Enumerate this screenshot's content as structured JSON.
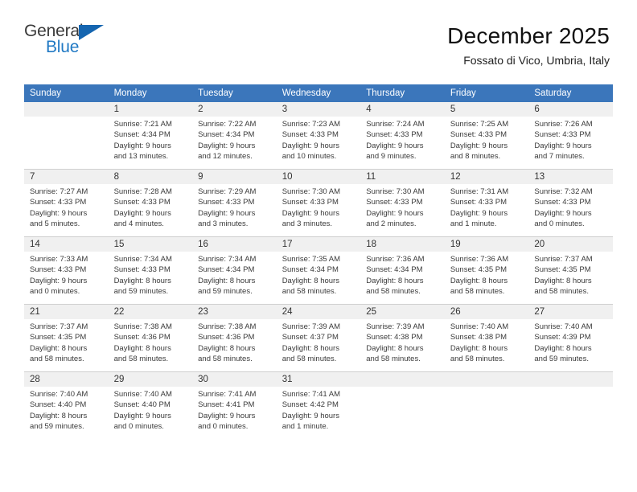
{
  "logo": {
    "general": "General",
    "blue": "Blue",
    "triangle": "blue-triangle-icon"
  },
  "header": {
    "title": "December 2025",
    "subtitle": "Fossato di Vico, Umbria, Italy"
  },
  "colors": {
    "header_blue": "#3b76bb",
    "logo_blue": "#2079c4",
    "daynum_bg": "#f0f0f0",
    "separator": "#cfcfcf"
  },
  "calendar": {
    "weekday_headers": [
      "Sunday",
      "Monday",
      "Tuesday",
      "Wednesday",
      "Thursday",
      "Friday",
      "Saturday"
    ],
    "weeks": [
      {
        "days": [
          {
            "num": "",
            "lines": []
          },
          {
            "num": "1",
            "lines": [
              "Sunrise: 7:21 AM",
              "Sunset: 4:34 PM",
              "Daylight: 9 hours",
              "and 13 minutes."
            ]
          },
          {
            "num": "2",
            "lines": [
              "Sunrise: 7:22 AM",
              "Sunset: 4:34 PM",
              "Daylight: 9 hours",
              "and 12 minutes."
            ]
          },
          {
            "num": "3",
            "lines": [
              "Sunrise: 7:23 AM",
              "Sunset: 4:33 PM",
              "Daylight: 9 hours",
              "and 10 minutes."
            ]
          },
          {
            "num": "4",
            "lines": [
              "Sunrise: 7:24 AM",
              "Sunset: 4:33 PM",
              "Daylight: 9 hours",
              "and 9 minutes."
            ]
          },
          {
            "num": "5",
            "lines": [
              "Sunrise: 7:25 AM",
              "Sunset: 4:33 PM",
              "Daylight: 9 hours",
              "and 8 minutes."
            ]
          },
          {
            "num": "6",
            "lines": [
              "Sunrise: 7:26 AM",
              "Sunset: 4:33 PM",
              "Daylight: 9 hours",
              "and 7 minutes."
            ]
          }
        ]
      },
      {
        "days": [
          {
            "num": "7",
            "lines": [
              "Sunrise: 7:27 AM",
              "Sunset: 4:33 PM",
              "Daylight: 9 hours",
              "and 5 minutes."
            ]
          },
          {
            "num": "8",
            "lines": [
              "Sunrise: 7:28 AM",
              "Sunset: 4:33 PM",
              "Daylight: 9 hours",
              "and 4 minutes."
            ]
          },
          {
            "num": "9",
            "lines": [
              "Sunrise: 7:29 AM",
              "Sunset: 4:33 PM",
              "Daylight: 9 hours",
              "and 3 minutes."
            ]
          },
          {
            "num": "10",
            "lines": [
              "Sunrise: 7:30 AM",
              "Sunset: 4:33 PM",
              "Daylight: 9 hours",
              "and 3 minutes."
            ]
          },
          {
            "num": "11",
            "lines": [
              "Sunrise: 7:30 AM",
              "Sunset: 4:33 PM",
              "Daylight: 9 hours",
              "and 2 minutes."
            ]
          },
          {
            "num": "12",
            "lines": [
              "Sunrise: 7:31 AM",
              "Sunset: 4:33 PM",
              "Daylight: 9 hours",
              "and 1 minute."
            ]
          },
          {
            "num": "13",
            "lines": [
              "Sunrise: 7:32 AM",
              "Sunset: 4:33 PM",
              "Daylight: 9 hours",
              "and 0 minutes."
            ]
          }
        ]
      },
      {
        "days": [
          {
            "num": "14",
            "lines": [
              "Sunrise: 7:33 AM",
              "Sunset: 4:33 PM",
              "Daylight: 9 hours",
              "and 0 minutes."
            ]
          },
          {
            "num": "15",
            "lines": [
              "Sunrise: 7:34 AM",
              "Sunset: 4:33 PM",
              "Daylight: 8 hours",
              "and 59 minutes."
            ]
          },
          {
            "num": "16",
            "lines": [
              "Sunrise: 7:34 AM",
              "Sunset: 4:34 PM",
              "Daylight: 8 hours",
              "and 59 minutes."
            ]
          },
          {
            "num": "17",
            "lines": [
              "Sunrise: 7:35 AM",
              "Sunset: 4:34 PM",
              "Daylight: 8 hours",
              "and 58 minutes."
            ]
          },
          {
            "num": "18",
            "lines": [
              "Sunrise: 7:36 AM",
              "Sunset: 4:34 PM",
              "Daylight: 8 hours",
              "and 58 minutes."
            ]
          },
          {
            "num": "19",
            "lines": [
              "Sunrise: 7:36 AM",
              "Sunset: 4:35 PM",
              "Daylight: 8 hours",
              "and 58 minutes."
            ]
          },
          {
            "num": "20",
            "lines": [
              "Sunrise: 7:37 AM",
              "Sunset: 4:35 PM",
              "Daylight: 8 hours",
              "and 58 minutes."
            ]
          }
        ]
      },
      {
        "days": [
          {
            "num": "21",
            "lines": [
              "Sunrise: 7:37 AM",
              "Sunset: 4:35 PM",
              "Daylight: 8 hours",
              "and 58 minutes."
            ]
          },
          {
            "num": "22",
            "lines": [
              "Sunrise: 7:38 AM",
              "Sunset: 4:36 PM",
              "Daylight: 8 hours",
              "and 58 minutes."
            ]
          },
          {
            "num": "23",
            "lines": [
              "Sunrise: 7:38 AM",
              "Sunset: 4:36 PM",
              "Daylight: 8 hours",
              "and 58 minutes."
            ]
          },
          {
            "num": "24",
            "lines": [
              "Sunrise: 7:39 AM",
              "Sunset: 4:37 PM",
              "Daylight: 8 hours",
              "and 58 minutes."
            ]
          },
          {
            "num": "25",
            "lines": [
              "Sunrise: 7:39 AM",
              "Sunset: 4:38 PM",
              "Daylight: 8 hours",
              "and 58 minutes."
            ]
          },
          {
            "num": "26",
            "lines": [
              "Sunrise: 7:40 AM",
              "Sunset: 4:38 PM",
              "Daylight: 8 hours",
              "and 58 minutes."
            ]
          },
          {
            "num": "27",
            "lines": [
              "Sunrise: 7:40 AM",
              "Sunset: 4:39 PM",
              "Daylight: 8 hours",
              "and 59 minutes."
            ]
          }
        ]
      },
      {
        "days": [
          {
            "num": "28",
            "lines": [
              "Sunrise: 7:40 AM",
              "Sunset: 4:40 PM",
              "Daylight: 8 hours",
              "and 59 minutes."
            ]
          },
          {
            "num": "29",
            "lines": [
              "Sunrise: 7:40 AM",
              "Sunset: 4:40 PM",
              "Daylight: 9 hours",
              "and 0 minutes."
            ]
          },
          {
            "num": "30",
            "lines": [
              "Sunrise: 7:41 AM",
              "Sunset: 4:41 PM",
              "Daylight: 9 hours",
              "and 0 minutes."
            ]
          },
          {
            "num": "31",
            "lines": [
              "Sunrise: 7:41 AM",
              "Sunset: 4:42 PM",
              "Daylight: 9 hours",
              "and 1 minute."
            ]
          },
          {
            "num": "",
            "lines": []
          },
          {
            "num": "",
            "lines": []
          },
          {
            "num": "",
            "lines": []
          }
        ]
      }
    ]
  }
}
